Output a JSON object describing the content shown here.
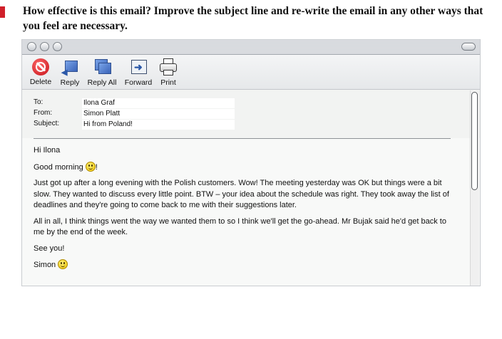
{
  "instructions": "How effective is this email? Improve the subject line and re-write the email in any other ways that you feel are necessary.",
  "toolbar": {
    "delete": "Delete",
    "reply": "Reply",
    "reply_all": "Reply All",
    "forward": "Forward",
    "print": "Print"
  },
  "headers": {
    "to_label": "To:",
    "to_value": "Ilona Graf",
    "from_label": "From:",
    "from_value": "Simon Platt",
    "subject_label": "Subject:",
    "subject_value": "Hi from Poland!"
  },
  "body": {
    "greeting": "Hi Ilona",
    "line2": "Good morning",
    "line2_suffix": "!",
    "para1": "Just got up after a long evening with the Polish customers. Wow! The meeting yesterday was OK but things were a bit slow. They wanted to discuss every little point. BTW – your idea about the schedule was right. They took away the list of deadlines and they're going to come back to me with their suggestions later.",
    "para2": "All in all, I think things went the way we wanted them to so I think we'll get the go-ahead. Mr Bujak said he'd get back to me by the end of the week.",
    "closing": "See you!",
    "signature": "Simon"
  },
  "icons": {
    "delete": "delete-icon",
    "reply": "reply-icon",
    "reply_all": "reply-all-icon",
    "forward": "forward-icon",
    "print": "printer-icon",
    "smiley": "smiley-icon"
  },
  "colors": {
    "marker": "#d0202a",
    "delete_red": "#c40f17",
    "toolbar_blue": "#3a63b8"
  }
}
